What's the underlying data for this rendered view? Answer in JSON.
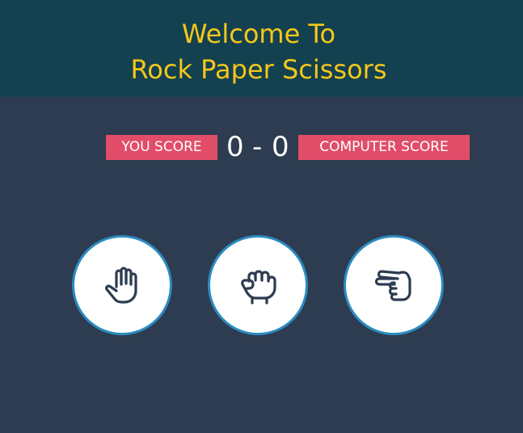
{
  "header": {
    "title_line1": "Welcome To",
    "title_line2": "Rock Paper Scissors"
  },
  "scoreboard": {
    "user_label": "YOU SCORE",
    "user_score": "0",
    "separator": "-",
    "computer_score": "0",
    "computer_label": "COMPUTER SCORE"
  },
  "choices": [
    {
      "icon": "hand-paper-icon"
    },
    {
      "icon": "hand-rock-icon"
    },
    {
      "icon": "hand-scissors-icon"
    }
  ],
  "colors": {
    "background": "#2d3c50",
    "header_bg": "#14414f",
    "title": "#f5c71a",
    "badge": "#e14d69",
    "circle_border": "#2b8bc1",
    "icon": "#2d3c50"
  }
}
